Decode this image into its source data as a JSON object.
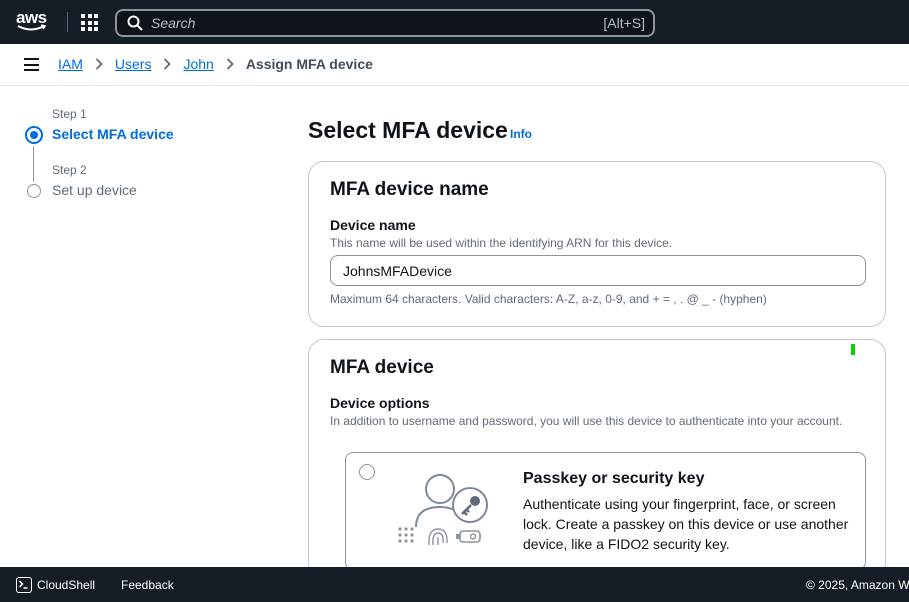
{
  "topnav": {
    "logo_text": "aws",
    "search_placeholder": "Search",
    "search_shortcut": "[Alt+S]"
  },
  "breadcrumb": {
    "links": [
      "IAM",
      "Users",
      "John"
    ],
    "current": "Assign MFA device"
  },
  "steps": [
    {
      "label": "Step 1",
      "title": "Select MFA device",
      "active": true
    },
    {
      "label": "Step 2",
      "title": "Set up device",
      "active": false
    }
  ],
  "main": {
    "title": "Select MFA device",
    "info": "Info",
    "name_card": {
      "heading": "MFA device name",
      "field_label": "Device name",
      "field_desc": "This name will be used within the identifying ARN for this device.",
      "value": "JohnsMFADevice",
      "constraint": "Maximum 64 characters. Valid characters: A-Z, a-z, 0-9, and + = , . @ _ - (hyphen)"
    },
    "device_card": {
      "heading": "MFA device",
      "options_label": "Device options",
      "options_desc": "In addition to username and password, you will use this device to authenticate into your account.",
      "option": {
        "title": "Passkey or security key",
        "desc": "Authenticate using your fingerprint, face, or screen lock. Create a passkey on this device or use another device, like a FIDO2 security key."
      }
    }
  },
  "footer": {
    "cloudshell": "CloudShell",
    "feedback": "Feedback",
    "copyright": "© 2025, Amazon W"
  },
  "colors": {
    "nav_bg": "#161d26",
    "link": "#006ce0",
    "border": "#c6c6cd"
  }
}
